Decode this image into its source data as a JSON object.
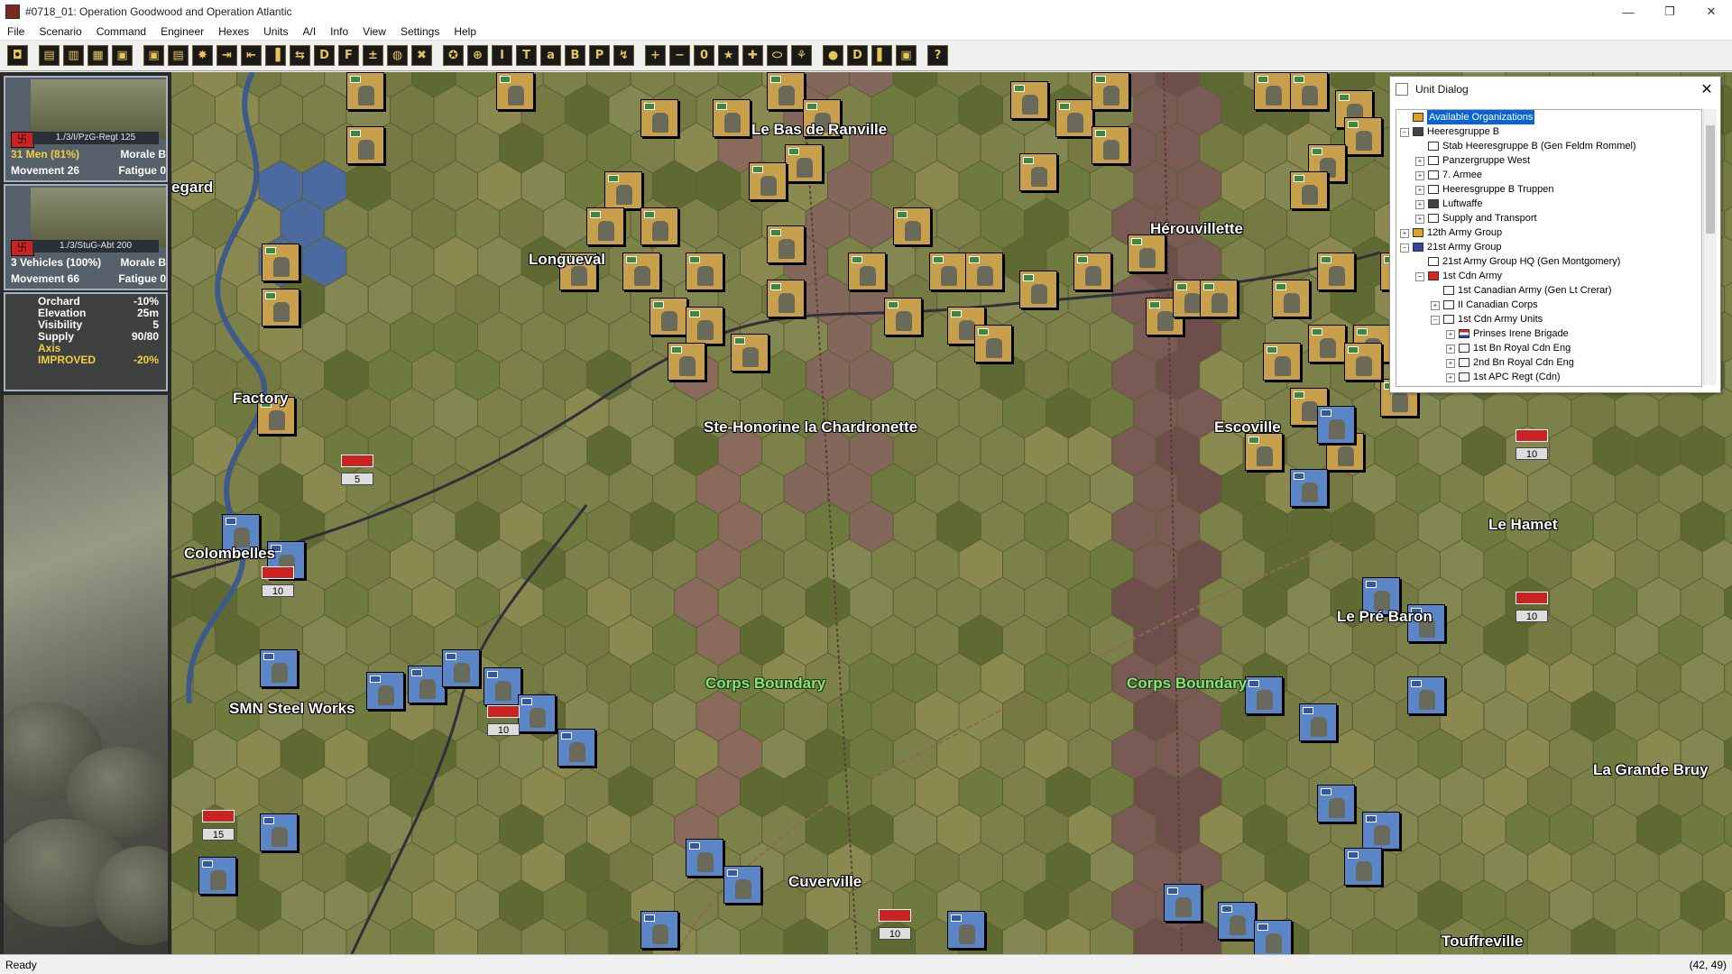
{
  "window": {
    "title": "#0718_01: Operation Goodwood and Operation Atlantic",
    "minimize": "—",
    "restore": "❐",
    "close": "✕"
  },
  "menu": [
    "File",
    "Scenario",
    "Command",
    "Engineer",
    "Hexes",
    "Units",
    "A/I",
    "Info",
    "View",
    "Settings",
    "Help"
  ],
  "toolbar": {
    "buttons": [
      "◘",
      "▤",
      "▥",
      "▦",
      "▣",
      "▣",
      "▤",
      "✸",
      "⇥",
      "⇤",
      "▐",
      "⇆",
      "D",
      "F",
      "±",
      "◍",
      "✖",
      "✪",
      "⊕",
      "I",
      "T",
      "a",
      "B",
      "P",
      "↯",
      "+",
      "−",
      "0",
      "★",
      "✚",
      "⬭",
      "⚘",
      "●",
      "D",
      "▌",
      "▣",
      "?"
    ]
  },
  "left": {
    "unit1": {
      "name": "1./3/I/PzG-Regt 125",
      "strength": "31 Men (81%)",
      "morale": "Morale B",
      "movement": "Movement 26",
      "fatigue": "Fatigue 0"
    },
    "unit2": {
      "name": "1./3/StuG-Abt 200",
      "strength": "3 Vehicles (100%)",
      "morale": "Morale B",
      "movement": "Movement 66",
      "fatigue": "Fatigue 0"
    },
    "terrain": {
      "rows": [
        {
          "k": "Orchard",
          "v": "-10%"
        },
        {
          "k": "Elevation",
          "v": "25m"
        },
        {
          "k": "Visibility",
          "v": "5"
        },
        {
          "k": "Supply",
          "v": "90/80"
        }
      ],
      "axis": "Axis",
      "improved_k": "IMPROVED",
      "improved_v": "-20%"
    }
  },
  "map": {
    "places": [
      "Le Bas de Ranville",
      "egard",
      "Longueval",
      "Hérouvillette",
      "Factory",
      "Ste-Honorine la Chardronette",
      "Escoville",
      "Colombelles",
      "Le Hamet",
      "Le Pré Baron",
      "SMN Steel Works",
      "Corps Boundary",
      "Corps Boundary",
      "La Grande Bruy",
      "Cuverville",
      "Touffreville"
    ],
    "stack_numbers": [
      "5",
      "10",
      "10",
      "15",
      "10",
      "10",
      "10"
    ]
  },
  "dialog": {
    "title": "Unit Dialog",
    "close": "✕",
    "tree": [
      {
        "label": "Available Organizations",
        "depth": 0,
        "pm": "",
        "sel": true,
        "icon": "star"
      },
      {
        "label": "Heeresgruppe B",
        "depth": 0,
        "pm": "−",
        "icon": "grid"
      },
      {
        "label": "Stab Heeresgruppe B (Gen Feldm Rommel)",
        "depth": 1,
        "pm": "",
        "icon": "box"
      },
      {
        "label": "Panzergruppe West",
        "depth": 1,
        "pm": "+",
        "icon": "box"
      },
      {
        "label": "7. Armee",
        "depth": 1,
        "pm": "+",
        "icon": "box"
      },
      {
        "label": "Heeresgruppe B Truppen",
        "depth": 1,
        "pm": "+",
        "icon": "box"
      },
      {
        "label": "Luftwaffe",
        "depth": 1,
        "pm": "+",
        "icon": "grid"
      },
      {
        "label": "Supply and Transport",
        "depth": 1,
        "pm": "+",
        "icon": "box"
      },
      {
        "label": "12th Army Group",
        "depth": 0,
        "pm": "+",
        "icon": "star"
      },
      {
        "label": "21st Army Group",
        "depth": 0,
        "pm": "−",
        "icon": "globe"
      },
      {
        "label": "21st Army Group HQ (Gen Montgomery)",
        "depth": 1,
        "pm": "",
        "icon": "box"
      },
      {
        "label": "1st Cdn Army",
        "depth": 1,
        "pm": "−",
        "icon": "leaf"
      },
      {
        "label": "1st Canadian Army (Gen Lt Crerar)",
        "depth": 2,
        "pm": "",
        "icon": "box"
      },
      {
        "label": "II Canadian Corps",
        "depth": 2,
        "pm": "+",
        "icon": "box"
      },
      {
        "label": "1st Cdn Army Units",
        "depth": 2,
        "pm": "−",
        "icon": "box"
      },
      {
        "label": "Prinses Irene Brigade",
        "depth": 3,
        "pm": "+",
        "icon": "nl"
      },
      {
        "label": "1st Bn Royal Cdn Eng",
        "depth": 3,
        "pm": "+",
        "icon": "box"
      },
      {
        "label": "2nd Bn Royal Cdn Eng",
        "depth": 3,
        "pm": "+",
        "icon": "box"
      },
      {
        "label": "1st APC Regt (Cdn)",
        "depth": 3,
        "pm": "+",
        "icon": "box"
      }
    ]
  },
  "status": {
    "left": "Ready",
    "right": "(42, 49)"
  },
  "colors": {
    "german": "#c89f4a",
    "allied": "#5a86c8",
    "grass": "#7c8049",
    "boundary_label": "#8ee07a",
    "selection": "#0a64d0"
  }
}
